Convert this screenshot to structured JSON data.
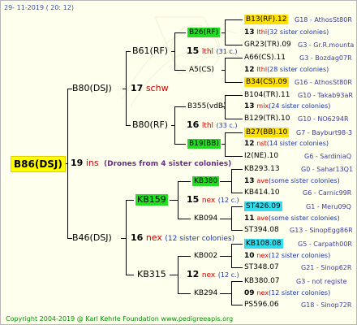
{
  "header": {
    "date": "29- 11-2019 ( 20: 12)"
  },
  "footer": {
    "copyright": "Copyright 2004-2019 @ Karl Kehrle Foundation   www.pedigreeapis.org"
  },
  "root": {
    "name": "B86(DSJ)",
    "num": "19",
    "suffix": "ins",
    "note": "(Drones from 4 sister colonies)"
  },
  "gen1": [
    {
      "name": "B80(DSJ)",
      "num": "17",
      "suffix": "schw"
    },
    {
      "name": "B46(DSJ)",
      "num": "16",
      "suffix": "nex",
      "note": "(12 sister colonies)"
    }
  ],
  "gen2": [
    {
      "name": "B61(RF)",
      "num": "15",
      "suffix": "lthl",
      "note": "(31 c.)"
    },
    {
      "name": "B80(RF)",
      "num": "16",
      "suffix": "lthl",
      "note": "(33 c.)"
    },
    {
      "name": "KB159",
      "num": "15",
      "suffix": "nex",
      "note": "(12 c.)"
    },
    {
      "name": "KB315",
      "num": "12",
      "suffix": "nex",
      "note": "(12 c.)"
    }
  ],
  "gen3": [
    {
      "name": "B26(RF)"
    },
    {
      "name": "A5(CS)"
    },
    {
      "name": "B355(vdB)"
    },
    {
      "name": "B19(BB)"
    },
    {
      "name": "KB380"
    },
    {
      "name": "KB094"
    },
    {
      "name": "KB002"
    },
    {
      "name": "KB294"
    }
  ],
  "gen4": [
    {
      "name": "B13(RF).12",
      "code": "G18 - AthosSt80R"
    },
    {
      "num": "13",
      "suffix": "lthl",
      "note": "(32 sister colonies)"
    },
    {
      "name": "GR23(TR).09",
      "code": "G3 - Gr.R.mounta"
    },
    {
      "name": "A66(CS).11",
      "code": "G3 - Bozdag07R"
    },
    {
      "num": "12",
      "suffix": "lthl",
      "note": "(28 sister colonies)"
    },
    {
      "name": "B34(CS).09",
      "code": "G16 - AthosSt80R"
    },
    {
      "name": "B104(TR).11",
      "code": "G10 - Takab93aR"
    },
    {
      "num": "13",
      "suffix": "mix",
      "note": "(24 sister colonies)"
    },
    {
      "name": "B129(TR).10",
      "code": "G10 - NO6294R"
    },
    {
      "name": "B27(BB).10",
      "code": "G7 - Bayburt98-3"
    },
    {
      "num": "12",
      "suffix": "nst",
      "note": "(14 sister colonies)"
    },
    {
      "name": "I2(NE).10",
      "code": "G6 - SardiniaQ"
    },
    {
      "name": "KB293.13",
      "code": "G0 - Sahar13Q1"
    },
    {
      "num": "13",
      "suffix": "ave",
      "note": "(some sister colonies)"
    },
    {
      "name": "KB414.10",
      "code": "G6 - Carnic99R"
    },
    {
      "name": "ST426.09",
      "code": "G1 - Meru09Q"
    },
    {
      "num": "11",
      "suffix": "ave",
      "note": "(some sister colonies)"
    },
    {
      "name": "ST394.08",
      "code": "G13 - SinopEgg86R"
    },
    {
      "name": "KB108.08",
      "code": "G5 - Carpath00R"
    },
    {
      "num": "10",
      "suffix": "nex",
      "note": "(12 sister colonies)"
    },
    {
      "name": "ST348.07",
      "code": "G21 - Sinop62R"
    },
    {
      "name": "KB380.07",
      "code": "G3 - not registe"
    },
    {
      "num": "09",
      "suffix": "nex",
      "note": "(12 sister colonies)"
    },
    {
      "name": "PS596.06",
      "code": "G18 - Sinop72R"
    }
  ]
}
